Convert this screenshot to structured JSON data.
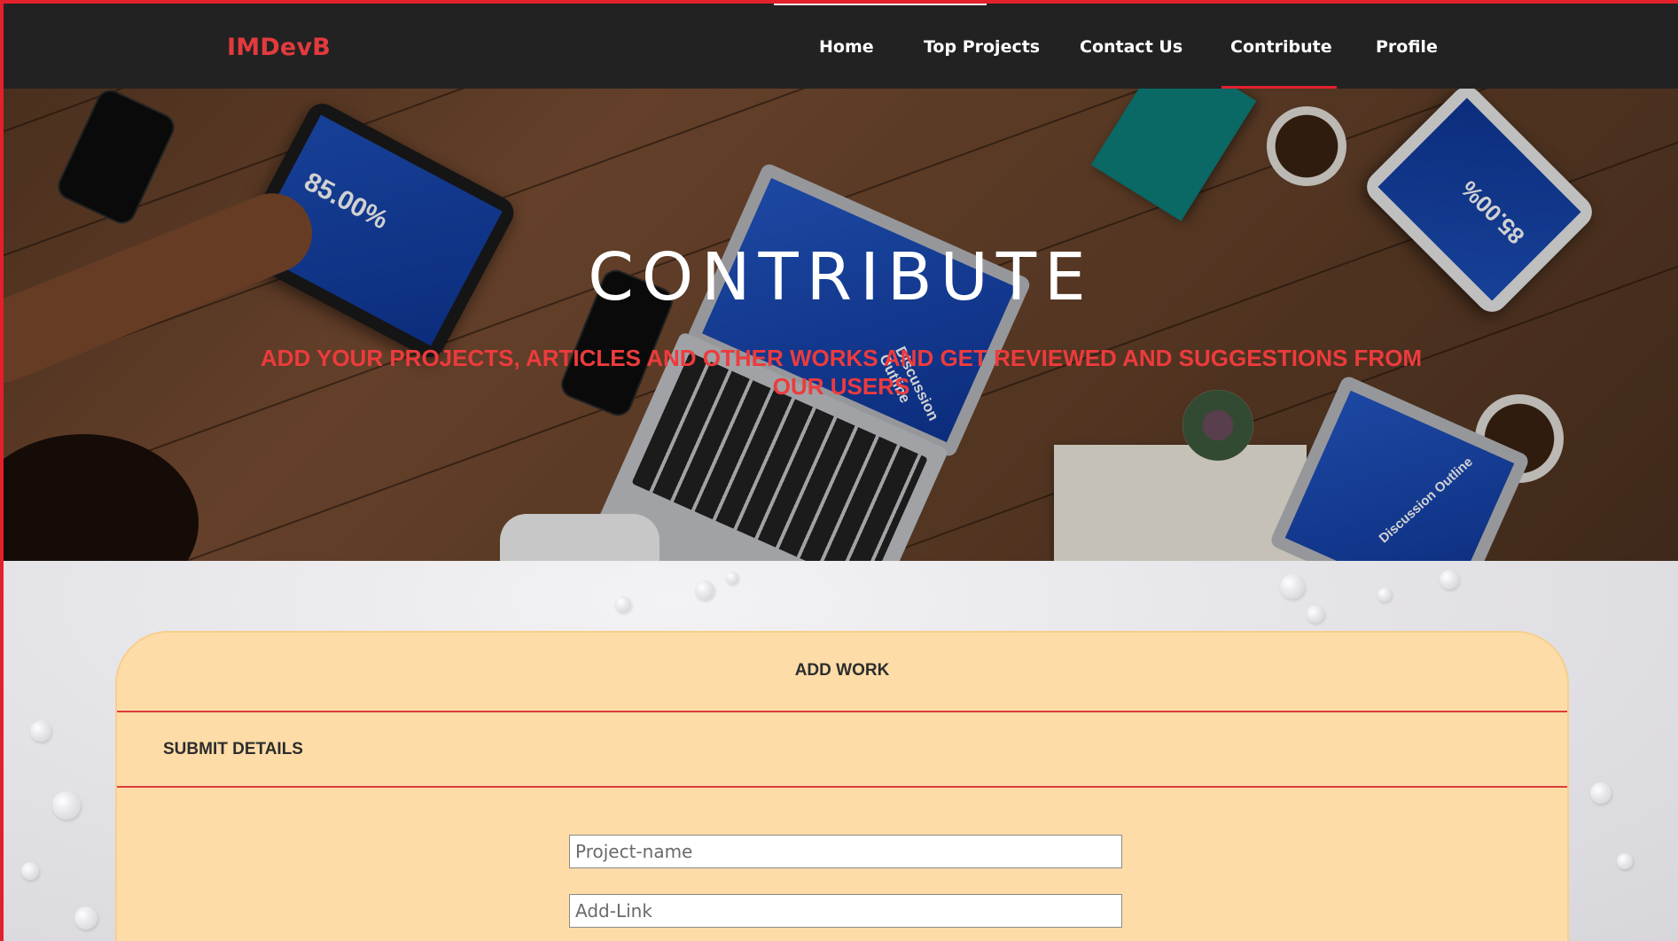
{
  "brand": "IMDevB",
  "nav": {
    "items": [
      {
        "label": "Home"
      },
      {
        "label": "Top Projects"
      },
      {
        "label": "Contact Us"
      },
      {
        "label": "Contribute"
      },
      {
        "label": "Profile"
      }
    ],
    "active": "Contribute"
  },
  "hero": {
    "title": "CONTRIBUTE",
    "subtitle": "ADD YOUR PROJECTS, ARTICLES AND OTHER WORKS AND GET REVIEWED AND SUGGESTIONS FROM OUR USERS",
    "tablet_left_text": "85.00%",
    "tablet_right_text": "85.00%",
    "laptop_text": "Discussion Outline",
    "laptop_right_text": "Discussion Outline"
  },
  "form": {
    "card_title": "ADD WORK",
    "section_title": "SUBMIT DETAILS",
    "project_name_placeholder": "Project-name",
    "add_link_placeholder": "Add-Link"
  },
  "colors": {
    "accent": "#e3202c",
    "brand": "#e33a3d",
    "navbar_bg": "#222222",
    "card_bg": "#fddca8"
  }
}
